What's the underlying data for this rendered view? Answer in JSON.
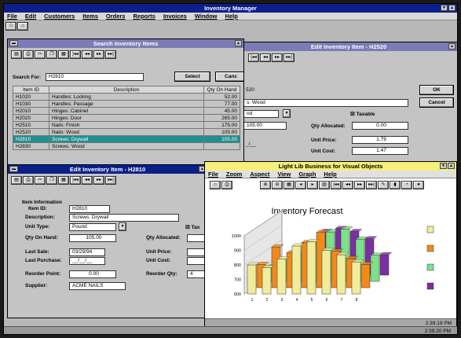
{
  "app": {
    "title": "Inventory Manager",
    "menu": [
      "File",
      "Edit",
      "Customers",
      "Items",
      "Orders",
      "Reports",
      "Invoices",
      "Window",
      "Help"
    ]
  },
  "search": {
    "title": "Search Inventory Items",
    "search_label": "Search For:",
    "search_value": "H2810",
    "select_label": "Select",
    "cancel_label": "Canc",
    "col_id": "Item ID",
    "col_desc": "Description",
    "col_qty": "Qty On Hand",
    "rows": [
      {
        "id": "H1020",
        "desc": "Handles: Locking",
        "qty": "52.00"
      },
      {
        "id": "H1030",
        "desc": "Handles: Passage",
        "qty": "77.00"
      },
      {
        "id": "H2010",
        "desc": "Hinges: Cabinet",
        "qty": "45.00"
      },
      {
        "id": "H2020",
        "desc": "Hinges: Door",
        "qty": "265.00"
      },
      {
        "id": "H2510",
        "desc": "Nails: Finish",
        "qty": "175.00"
      },
      {
        "id": "H2520",
        "desc": "Nails: Wood",
        "qty": "105.00"
      },
      {
        "id": "H2810",
        "desc": "Screws: Drywall",
        "qty": "105.00"
      },
      {
        "id": "H2830",
        "desc": "Screws: Wood",
        "qty": ""
      }
    ]
  },
  "edit_back": {
    "title": "Edit Inventory Item - H2520",
    "item_id": "520",
    "description": "s: Wood",
    "unit_type": "nd",
    "taxable_label": "Taxable",
    "qty_on_hand": "105.00",
    "qty_allocated_label": "Qty Allocated:",
    "qty_allocated": "0.00",
    "unit_price_label": "Unit Price:",
    "unit_price": "1.79",
    "unit_cost_label": "Unit Cost:",
    "unit_cost": "1.47",
    "ok_label": "OK",
    "cancel_label": "Cancel"
  },
  "edit_front": {
    "title": "Edit Inventory Item - H2810",
    "section": "Item Information",
    "item_id_label": "Item ID:",
    "item_id": "H2810",
    "desc_label": "Description:",
    "desc": "Screws: Drywall",
    "unit_type_label": "Unit Type:",
    "unit_type": "Pound",
    "taxable_label": "Tax",
    "qty_label": "Qty On Hand:",
    "qty": "105.00",
    "qty_alloc_label": "Qty Allocated:",
    "last_sale_label": "Last Sale:",
    "last_sale": "03/29/94",
    "unit_price_label": "Unit Price:",
    "last_purchase_label": "Last Purchase:",
    "last_purchase": "__/__/__",
    "unit_cost_label": "Unit Cost:",
    "reorder_point_label": "Reorder Point:",
    "reorder_point": "0.00",
    "reorder_qty_label": "Reorder Qty:",
    "reorder_qty": "4",
    "supplier_label": "Supplier:",
    "supplier": "ACME NAILS"
  },
  "graph": {
    "title": "Light Lib Business for Visual Objects",
    "menu": [
      "File",
      "Zoom",
      "Aspect",
      "View",
      "Graph",
      "Help"
    ],
    "status_time": "2:39:19 PM",
    "colors": {
      "yellow": "#f0ec9a",
      "orange": "#f08a1a",
      "green": "#7ee08a",
      "purple": "#7b2fa0"
    }
  },
  "status": {
    "time": "2:39:20 PM"
  },
  "chart_data": {
    "type": "bar",
    "title": "Inventory Forecast",
    "categories": [
      "1",
      "2",
      "3",
      "4",
      "5",
      "6",
      "7",
      "8"
    ],
    "ylim": [
      600,
      1000
    ],
    "yticks": [
      600,
      700,
      800,
      900,
      1000
    ],
    "series": [
      {
        "values": [
          800,
          780,
          840,
          930,
          960,
          900,
          870,
          820
        ],
        "color": "#f0ec9a"
      },
      {
        "values": [
          760,
          880,
          840,
          910,
          980,
          850,
          800,
          760
        ],
        "color": "#f08a1a"
      },
      {
        "values": [
          700,
          740,
          790,
          860,
          940,
          960,
          890,
          780
        ],
        "color": "#7ee08a"
      },
      {
        "values": [
          680,
          700,
          760,
          900,
          920,
          900,
          850,
          740
        ],
        "color": "#7b2fa0"
      }
    ]
  }
}
